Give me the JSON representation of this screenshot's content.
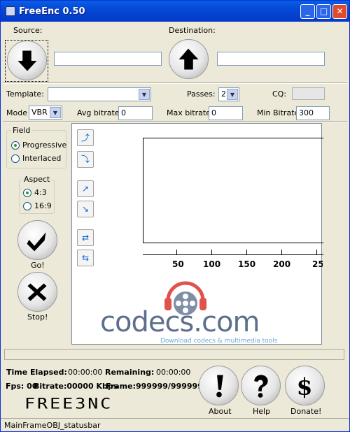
{
  "window": {
    "title": "FreeEnc 0.50",
    "minimize": "_",
    "maximize": "□",
    "close": "✕"
  },
  "source": {
    "label": "Source:",
    "value": ""
  },
  "destination": {
    "label": "Destination:",
    "value": ""
  },
  "template": {
    "label": "Template:",
    "value": ""
  },
  "passes": {
    "label": "Passes:",
    "value": "2"
  },
  "cq": {
    "label": "CQ:",
    "value": ""
  },
  "mode": {
    "label": "Mode",
    "value": "VBR"
  },
  "avg_bitrate": {
    "label": "Avg bitrate:",
    "value": "0"
  },
  "max_bitrate": {
    "label": "Max bitrate:",
    "value": "0"
  },
  "min_bitrate": {
    "label": "Min Bitrate:",
    "value": "300"
  },
  "field": {
    "label": "Field",
    "options": [
      "Progressive",
      "Interlaced"
    ],
    "selected": "Progressive"
  },
  "aspect": {
    "label": "Aspect",
    "options": [
      "4:3",
      "16:9"
    ],
    "selected": "4:3"
  },
  "buttons": {
    "go": "Go!",
    "stop": "Stop!",
    "about": "About",
    "help": "Help",
    "donate": "Donate!"
  },
  "timeline": {
    "ticks": [
      "50",
      "100",
      "150",
      "200",
      "25"
    ]
  },
  "banner": {
    "brand": "codecs.com",
    "tagline": "Download codecs & multimedia tools"
  },
  "stats": {
    "time_elapsed_label": "Time Elapsed:",
    "time_elapsed": "00:00:00",
    "remaining_label": "Remaining:",
    "remaining": "00:00:00",
    "fps": "Fps: 00",
    "bitrate": "Bitrate:00000 Kbps",
    "frame": "Frame:999999/999999"
  },
  "logo": {
    "text": "FREE3NC"
  },
  "statusbar": {
    "text": "MainFrameOBJ_statusbar"
  },
  "icons": [
    "down-arrow-icon",
    "up-arrow-icon",
    "checkmark-icon",
    "x-icon",
    "exclamation-icon",
    "question-icon",
    "dollar-icon"
  ]
}
